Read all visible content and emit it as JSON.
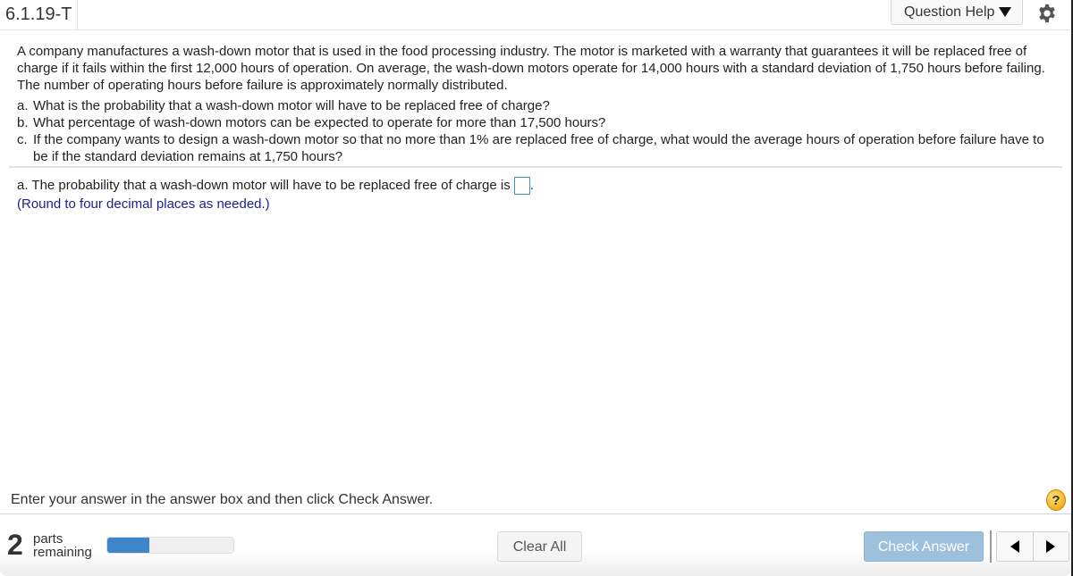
{
  "header": {
    "question_id": "6.1.19-T",
    "question_help_label": "Question Help",
    "settings_icon": "gear-icon"
  },
  "problem": {
    "intro": "A company manufactures a wash-down motor that is used in the food processing industry. The motor is marketed with a warranty that guarantees it will be replaced free of charge if it fails within the first 12,000 hours of operation. On average, the wash-down motors operate for 14,000 hours with a standard deviation of 1,750 hours before failing. The number of operating hours before failure is approximately normally distributed.",
    "items": [
      {
        "label": "a.",
        "text": "What is the probability that a wash-down motor will have to be replaced free of charge?"
      },
      {
        "label": "b.",
        "text": "What percentage of wash-down motors can be expected to operate for more than 17,500 hours?"
      },
      {
        "label": "c.",
        "text": "If the company wants to design a wash-down motor so that no more than 1% are replaced free of charge, what would the average hours of operation before failure have to be if the standard deviation remains at 1,750 hours?"
      }
    ]
  },
  "answer": {
    "prompt": "a. The probability that a wash-down motor will have to be replaced free of charge is",
    "value": "",
    "suffix": ".",
    "hint": "(Round to four decimal places as needed.)"
  },
  "instruction": "Enter your answer in the answer box and then click Check Answer.",
  "help_button": "?",
  "footer": {
    "parts_count": "2",
    "parts_label_1": "parts",
    "parts_label_2": "remaining",
    "progress_fraction": 0.33,
    "clear_all_label": "Clear All",
    "check_answer_label": "Check Answer",
    "prev_icon": "left-triangle-icon",
    "next_icon": "right-triangle-icon"
  },
  "colors": {
    "progress_fill": "#3d87c9",
    "check_button": "#9dc0dd",
    "hint_text": "#1a1f8f",
    "answer_box_border": "#3a96c4"
  }
}
